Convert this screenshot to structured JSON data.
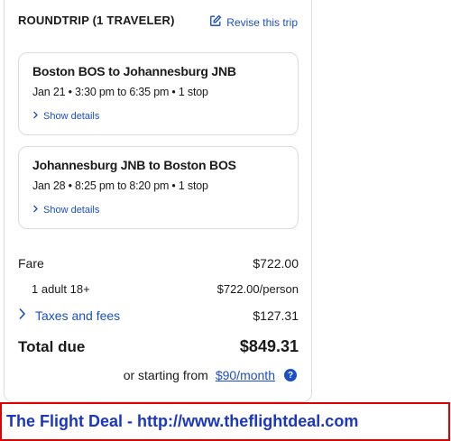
{
  "trip": {
    "title": "ROUNDTRIP (1 TRAVELER)",
    "revise_label": "Revise this trip"
  },
  "legs": [
    {
      "route": "Boston BOS to Johannesburg JNB",
      "times": "Jan 21 • 3:30 pm to 6:35 pm • 1 stop",
      "details_label": "Show details"
    },
    {
      "route": "Johannesburg JNB to Boston BOS",
      "times": "Jan 28 • 8:25 pm to 8:20 pm • 1 stop",
      "details_label": "Show details"
    }
  ],
  "pricing": {
    "fare_label": "Fare",
    "fare_value": "$722.00",
    "adult_label": "1 adult 18+",
    "adult_value": "$722.00/person",
    "taxes_label": "Taxes and fees",
    "taxes_value": "$127.31",
    "total_label": "Total due",
    "total_value": "$849.31"
  },
  "financing": {
    "prefix": "or starting from",
    "link": "$90/month",
    "help_symbol": "?"
  },
  "banner": {
    "text": "The Flight Deal - http://www.theflightdeal.com"
  },
  "colors": {
    "accent": "#1b4fc6",
    "banner_border": "#e00000",
    "banner_text": "#1a36c8"
  }
}
